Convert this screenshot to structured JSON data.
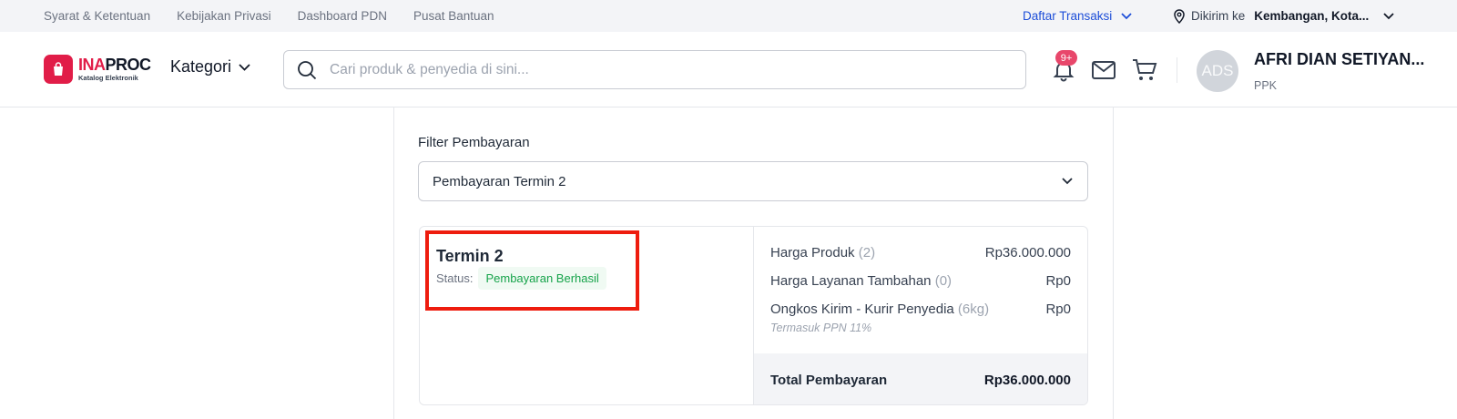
{
  "topbar": {
    "links": [
      "Syarat & Ketentuan",
      "Kebijakan Privasi",
      "Dashboard PDN",
      "Pusat Bantuan"
    ],
    "transactions_label": "Daftar Transaksi",
    "ship_label": "Dikirim ke",
    "ship_location": "Kembangan, Kota..."
  },
  "header": {
    "logo_main": "INAPROC",
    "logo_sub": "Katalog Elektronik",
    "kategori_label": "Kategori",
    "search_placeholder": "Cari produk & penyedia di sini...",
    "notif_count": "9+",
    "avatar_initials": "ADS",
    "user_name": "AFRI DIAN SETIYAN...",
    "user_role": "PPK"
  },
  "filter": {
    "label": "Filter Pembayaran",
    "selected": "Pembayaran Termin 2"
  },
  "termin": {
    "title": "Termin 2",
    "status_label": "Status:",
    "status_value": "Pembayaran Berhasil"
  },
  "summary": {
    "rows": [
      {
        "label": "Harga Produk",
        "qty": "(2)",
        "value": "Rp36.000.000"
      },
      {
        "label": "Harga Layanan Tambahan",
        "qty": "(0)",
        "value": "Rp0"
      },
      {
        "label": "Ongkos Kirim - Kurir Penyedia",
        "qty": "(6kg)",
        "value": "Rp0"
      }
    ],
    "tax_note": "Termasuk PPN 11%",
    "total_label": "Total Pembayaran",
    "total_value": "Rp36.000.000"
  },
  "colors": {
    "brand": "#e11d48",
    "link_blue": "#1d4ed8",
    "success": "#16a34a",
    "highlight": "#ee1c0e"
  }
}
